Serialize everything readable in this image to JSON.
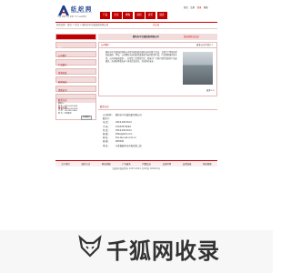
{
  "logo": {
    "name": "纺 织 网",
    "url": "www.tex-net.com.cn",
    "slogan": "中国 纺织行业 纺织 门户 B2B网站"
  },
  "top_links": [
    "首页",
    "注册",
    "登录",
    "帮助"
  ],
  "nav": [
    "产品",
    "企业",
    "求购",
    "商机",
    "资讯",
    "展会"
  ],
  "breadcrumb": "您的位置：首页 > 企业 > 廊坊市中合盛纺织有限公司",
  "breadcrumb_tag": "已认证",
  "sidebar": {
    "items": [
      "首页",
      "公司简介",
      "产品展示",
      "供求信息",
      "新闻动态",
      "资质证书",
      "联系我们",
      "留言反馈"
    ],
    "contact_title": "联系方式",
    "contact_lines": [
      "联系人：",
      "电 话：0316-6213414",
      "传 真：0316-6213414",
      "手 机：15033573664",
      "地 址：河北廊坊"
    ],
    "contact_button": "在线留言"
  },
  "company": {
    "name": "廊坊市中合盛纺织有限公司",
    "verified": "营业执照已认证",
    "intro_title": "公司简介",
    "intro_more": "更多公司介绍>>",
    "intro": "廊坊市中合盛纺织有限公司是中国纺织品制造业中的骨干企业，主要生产经营各类纺织面料、坯布，公司拥有先进的织造设备和完善的检测手段，产品畅销国内外市场。公司本着质量第一、信誉至上的经营宗旨，竭诚为广大客户提供优质的产品和服务。欢迎各界朋友来人来电洽谈业务，共创美好未来。",
    "intro_more2": "更多>>"
  },
  "contact": {
    "title": "联系方式",
    "rows": [
      {
        "k": "公司名称：",
        "v": "廊坊市中合盛纺织有限公司"
      },
      {
        "k": "联系人：",
        "v": ""
      },
      {
        "k": "电 话：",
        "v": "0316-6213414"
      },
      {
        "k": "手 机：",
        "v": "15033573664"
      },
      {
        "k": "传 真：",
        "v": "0316-6213414"
      },
      {
        "k": "邮 箱：",
        "v": "lfzhs@163.com"
      },
      {
        "k": "网 址：",
        "v": "zhs.tex-net.com.cn"
      },
      {
        "k": "邮 编：",
        "v": "065000"
      },
      {
        "k": "地 址：",
        "v": "河北省廊坊市开发区第二街"
      }
    ]
  },
  "footer_links": [
    "关于我们",
    "联系方式",
    "网站地图",
    "广告服务",
    "付费会员",
    "法律声明",
    "友情链接",
    "网站帮助"
  ],
  "copyright": "纺织网 版权所有 1997-2024 京ICP证 000001号",
  "watermark": "千狐网收录"
}
